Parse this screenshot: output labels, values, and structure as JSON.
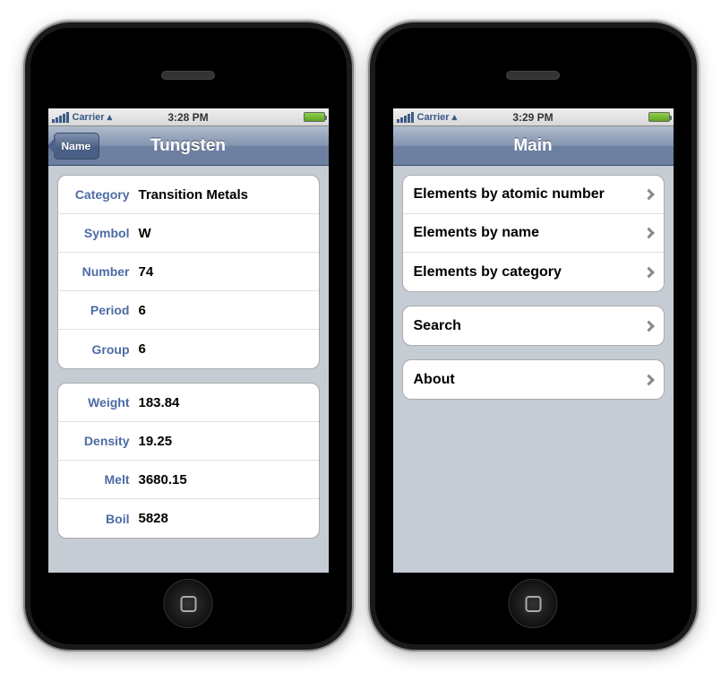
{
  "left": {
    "status": {
      "carrier": "Carrier",
      "time": "3:28 PM"
    },
    "nav": {
      "title": "Tungsten",
      "back": "Name"
    },
    "group1": [
      {
        "label": "Category",
        "value": "Transition Metals"
      },
      {
        "label": "Symbol",
        "value": "W"
      },
      {
        "label": "Number",
        "value": "74"
      },
      {
        "label": "Period",
        "value": "6"
      },
      {
        "label": "Group",
        "value": "6"
      }
    ],
    "group2": [
      {
        "label": "Weight",
        "value": "183.84"
      },
      {
        "label": "Density",
        "value": "19.25"
      },
      {
        "label": "Melt",
        "value": "3680.15"
      },
      {
        "label": "Boil",
        "value": "5828"
      }
    ]
  },
  "right": {
    "status": {
      "carrier": "Carrier",
      "time": "3:29 PM"
    },
    "nav": {
      "title": "Main"
    },
    "group1": [
      {
        "label": "Elements by atomic number"
      },
      {
        "label": "Elements by name"
      },
      {
        "label": "Elements by category"
      }
    ],
    "group2": [
      {
        "label": "Search"
      }
    ],
    "group3": [
      {
        "label": "About"
      }
    ]
  }
}
